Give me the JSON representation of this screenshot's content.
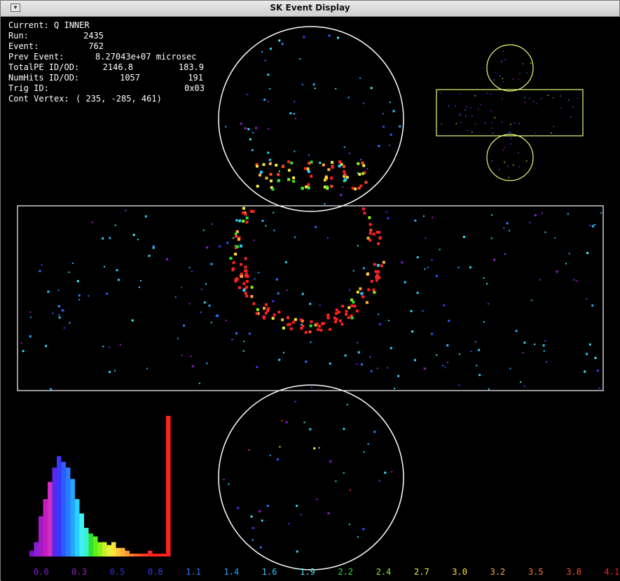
{
  "window": {
    "title": "SK Event Display",
    "menu_icon": "triangle-down-icon"
  },
  "info_panel": {
    "lines": [
      {
        "label": "Current: Q   INNER"
      },
      {
        "label": "Run:",
        "value": "2435"
      },
      {
        "label": "Event:",
        "value": "762"
      },
      {
        "label": "Prev Event:",
        "value": "8.27043e+07 microsec"
      },
      {
        "label": "TotalPE ID/OD:",
        "value": "2146.8",
        "value2": "183.9"
      },
      {
        "label": "NumHits ID/OD:",
        "value": "1057",
        "value2": "191"
      },
      {
        "label": "Trig ID:",
        "value": "0x03"
      },
      {
        "label": "Cont Vertex:",
        "value": "(  235, -285,  461)"
      }
    ]
  },
  "color_scale": {
    "labels": [
      "0.0",
      "0.3",
      "0.5",
      "0.8",
      "1.1",
      "1.4",
      "1.6",
      "1.9",
      "2.2",
      "2.4",
      "2.7",
      "3.0",
      "3.2",
      "3.5",
      "3.8",
      "4.1"
    ],
    "colors": [
      "#8c1cd6",
      "#a21cc6",
      "#3a2ae6",
      "#3a38ff",
      "#2a7cff",
      "#24a6ff",
      "#28d0ff",
      "#42f0f0",
      "#2ce22c",
      "#8ef018",
      "#e8f03c",
      "#ffe23a",
      "#ffb03a",
      "#ff7a2a",
      "#ff4a26",
      "#ff2020"
    ]
  },
  "histogram": {
    "values": [
      2,
      5,
      14,
      20,
      26,
      31,
      35,
      33,
      31,
      27,
      20,
      15,
      10,
      8,
      7,
      5,
      5,
      4,
      5,
      3,
      3,
      2,
      1,
      1,
      1,
      1,
      2,
      1,
      1,
      1,
      49
    ],
    "colors": [
      "#7a10c8",
      "#8c1cd6",
      "#a21cc6",
      "#c21cc0",
      "#d22cc6",
      "#5a2ae6",
      "#3a38ff",
      "#2a5cff",
      "#2a7cff",
      "#24a6ff",
      "#28d0ff",
      "#42f0f0",
      "#38f0d0",
      "#2ce22c",
      "#5ef018",
      "#8ef018",
      "#c8f02a",
      "#e8f03c",
      "#ffe23a",
      "#ffc83a",
      "#ffb03a",
      "#ff9a30",
      "#ff7a2a",
      "#ff6226",
      "#ff4a26",
      "#ff3a22",
      "#ff2a20",
      "#ff2020",
      "#ff2020",
      "#ff2020",
      "#ff2020"
    ]
  },
  "detector": {
    "id_top_hits": 60,
    "id_barrel_hits": 220,
    "id_bottom_hits": 42,
    "ring_hits": 190,
    "od_hits": 80
  }
}
